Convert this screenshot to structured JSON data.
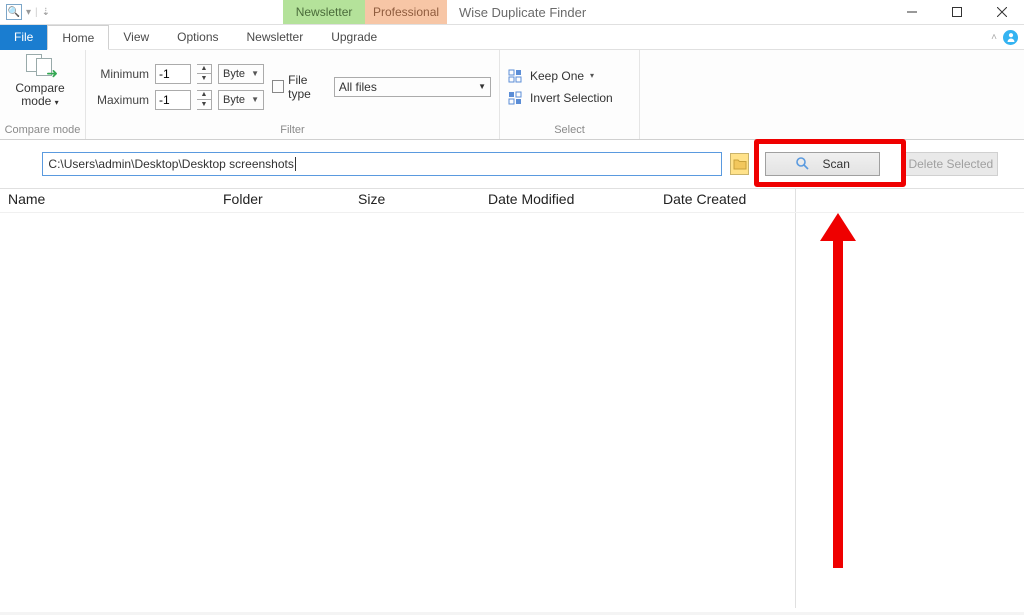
{
  "titlebar": {
    "title": "Wise Duplicate Finder",
    "badges": {
      "newsletter": "Newsletter",
      "professional": "Professional"
    }
  },
  "tabs": {
    "file": "File",
    "home": "Home",
    "view": "View",
    "options": "Options",
    "newsletter": "Newsletter",
    "upgrade": "Upgrade"
  },
  "ribbon": {
    "compare_mode_group": {
      "label": "Compare mode",
      "button_line1": "Compare",
      "button_line2": "mode"
    },
    "filter_group": {
      "label": "Filter",
      "minimum_label": "Minimum",
      "maximum_label": "Maximum",
      "min_value": "-1",
      "max_value": "-1",
      "unit": "Byte",
      "filetype_label": "File type",
      "filetype_value": "All files"
    },
    "select_group": {
      "label": "Select",
      "keep_one": "Keep One",
      "invert_selection": "Invert Selection"
    }
  },
  "path_row": {
    "path_value": "C:\\Users\\admin\\Desktop\\Desktop screenshots",
    "scan_label": "Scan",
    "delete_label": "Delete Selected"
  },
  "columns": {
    "name": "Name",
    "folder": "Folder",
    "size": "Size",
    "date_modified": "Date Modified",
    "date_created": "Date Created"
  }
}
